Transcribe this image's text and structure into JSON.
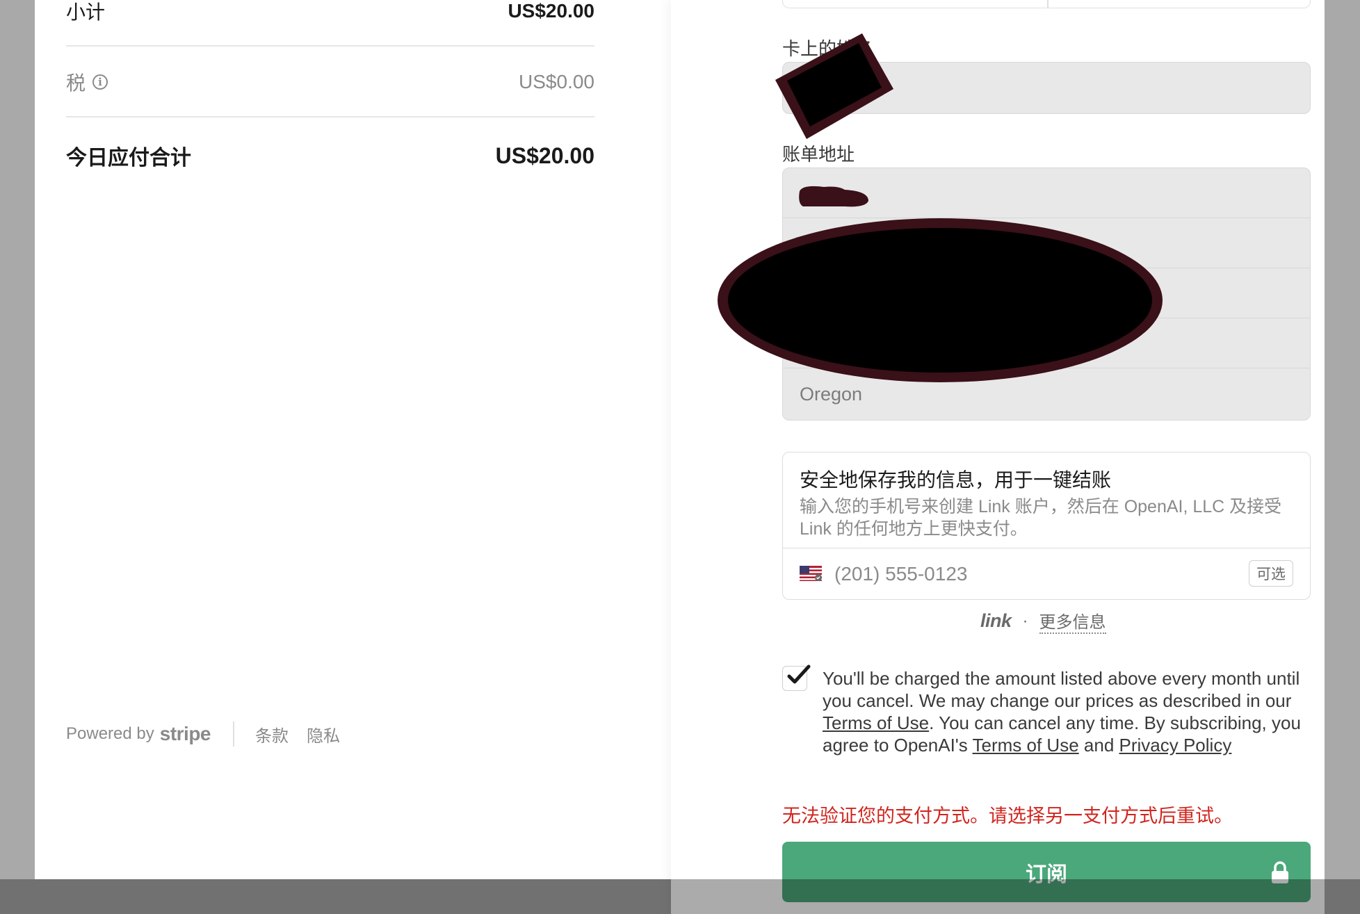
{
  "order_summary": {
    "subtotal_label": "小计",
    "subtotal_value": "US$20.00",
    "tax_label": "税",
    "tax_value": "US$0.00",
    "total_label": "今日应付合计",
    "total_value": "US$20.00"
  },
  "footer": {
    "powered_by": "Powered by",
    "brand": "stripe",
    "terms": "条款",
    "privacy": "隐私"
  },
  "form": {
    "cardholder_label": "卡上的姓名",
    "billing_address_label": "账单地址",
    "state_value": "Oregon"
  },
  "link": {
    "title": "安全地保存我的信息，用于一键结账",
    "description": "输入您的手机号来创建 Link 账户，然后在 OpenAI, LLC 及接受 Link 的任何地方上更快支付。",
    "phone_placeholder": "(201) 555-0123",
    "optional_badge": "可选",
    "logo": "link",
    "dot": "·",
    "more_info": "更多信息"
  },
  "consent": {
    "checked": true,
    "text_1": "You'll be charged the amount listed above every month until you cancel. We may change our prices as described in our ",
    "terms_link_1": "Terms of Use",
    "text_2": ". You can cancel any time. By subscribing, you agree to OpenAI's ",
    "terms_link_2": "Terms of Use",
    "text_3": " and ",
    "privacy_link": "Privacy Policy"
  },
  "error_message": "无法验证您的支付方式。请选择另一支付方式后重试。",
  "subscribe_button": "订阅",
  "colors": {
    "accent_green": "#4ba87a",
    "error_red": "#d0251e",
    "redaction": "#3a1019"
  }
}
